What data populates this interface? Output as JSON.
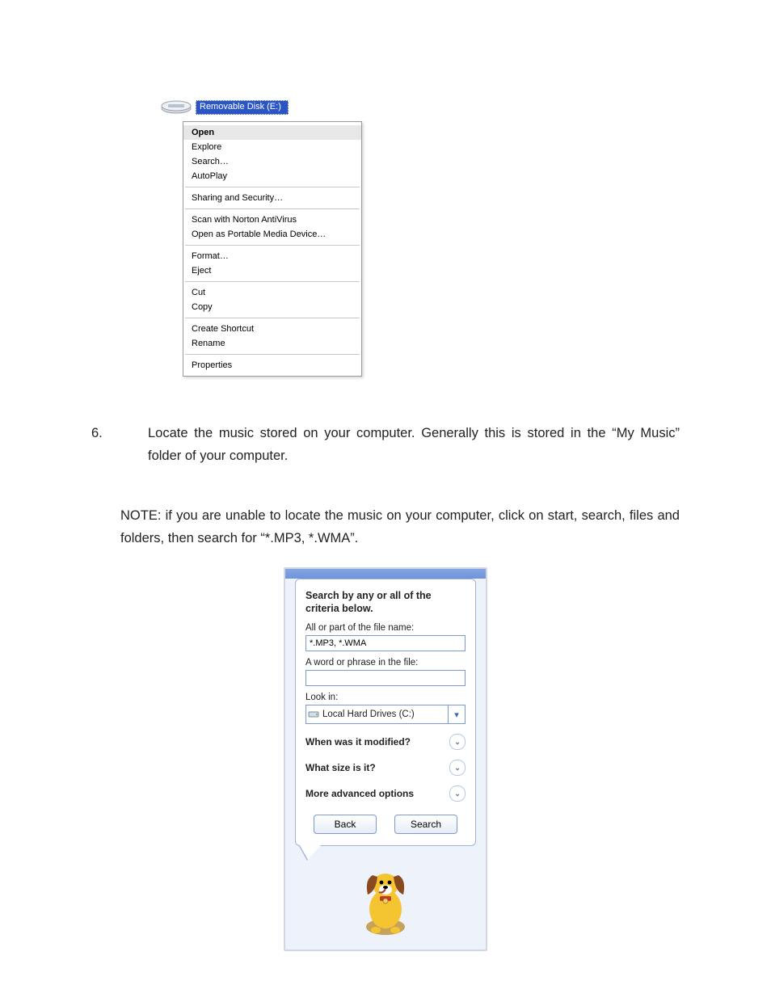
{
  "context_menu": {
    "drive_label": "Removable Disk (E:)",
    "groups": [
      [
        "Open",
        "Explore",
        "Search…",
        "AutoPlay"
      ],
      [
        "Sharing and Security…"
      ],
      [
        "Scan with Norton AntiVirus",
        "Open as Portable Media Device…"
      ],
      [
        "Format…",
        "Eject"
      ],
      [
        "Cut",
        "Copy"
      ],
      [
        "Create Shortcut",
        "Rename"
      ],
      [
        "Properties"
      ]
    ],
    "bold_item": "Open"
  },
  "body": {
    "step_number": "6.",
    "step_text": "Locate the music stored on your computer. Generally this is stored in the “My Music” folder of your computer.",
    "note_text": "NOTE:  if you are unable to locate the music on your computer, click on start, search, files and folders,  then search for “*.MP3, *.WMA”."
  },
  "search_panel": {
    "title": "Search by any or all of the criteria below.",
    "filename_label": "All or part of the file name:",
    "filename_value": "*.MP3, *.WMA",
    "phrase_label": "A word or phrase in the file:",
    "phrase_value": "",
    "lookin_label": "Look in:",
    "lookin_value": "Local Hard Drives (C:)",
    "expanders": [
      "When was it modified?",
      "What size is it?",
      "More advanced options"
    ],
    "back_button": "Back",
    "search_button": "Search"
  }
}
